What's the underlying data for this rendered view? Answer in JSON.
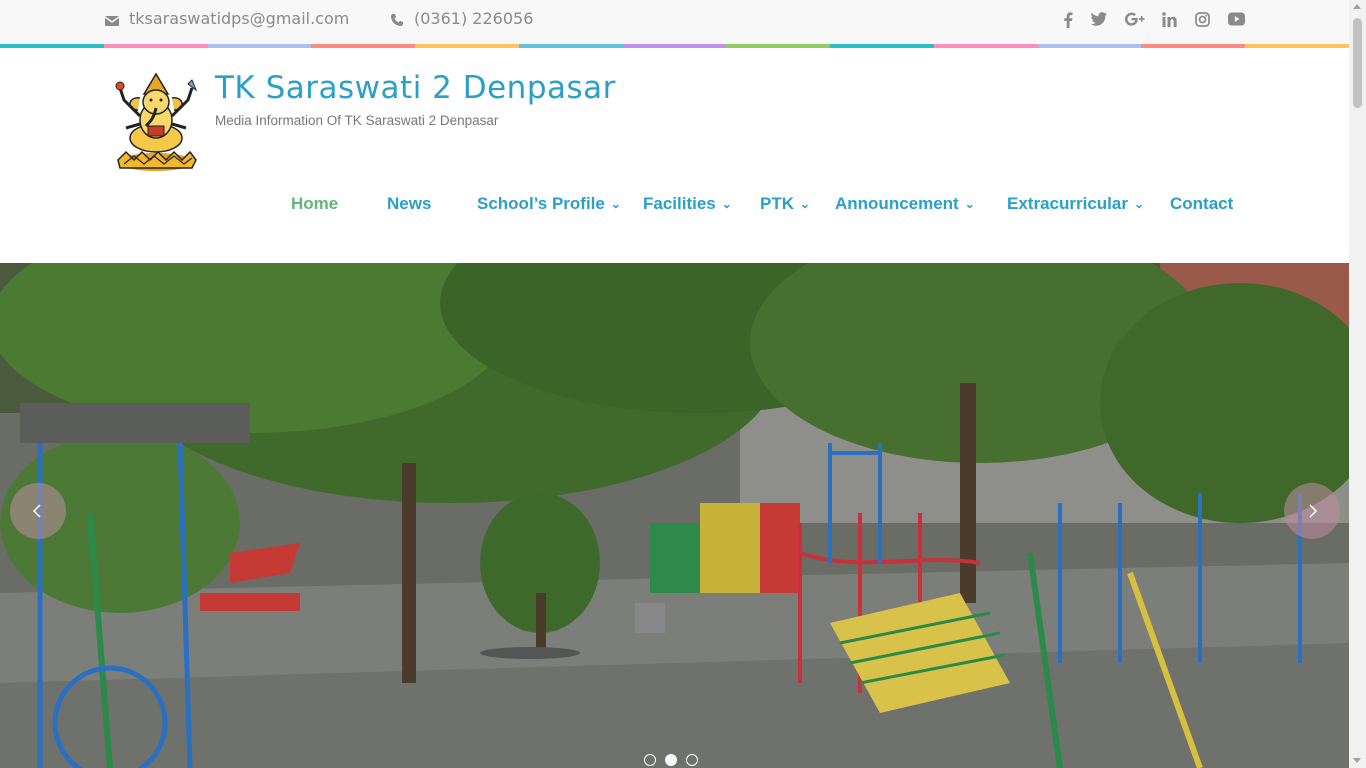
{
  "topbar": {
    "email": "tksaraswatidps@gmail.com",
    "phone": "(0361) 226056",
    "social": [
      "facebook-icon",
      "twitter-icon",
      "google-plus-icon",
      "linkedin-icon",
      "instagram-icon",
      "youtube-icon"
    ]
  },
  "stripe_colors": [
    "#2bbdc9",
    "#ff8fb8",
    "#a9c0f0",
    "#ff8a80",
    "#ffc25c",
    "#5ec2dd",
    "#c38ef3",
    "#8fcf62",
    "#2bbdc9",
    "#ff8fb8",
    "#a9c0f0",
    "#ff8a80",
    "#ffc25c"
  ],
  "site": {
    "title": "TK Saraswati 2 Denpasar",
    "tagline": "Media Information Of TK Saraswati 2 Denpasar"
  },
  "nav": {
    "home": "Home",
    "news": "News",
    "profile": "School’s Profile",
    "facilities": "Facilities",
    "ptk": "PTK",
    "announcement": "Announcement",
    "extracurricular": "Extracurricular",
    "contact": "Contact"
  },
  "slider": {
    "slide_count": 3,
    "active_slide": 2
  },
  "colors": {
    "nav_link": "#2aa0c8",
    "nav_active": "#5fb87a",
    "title": "#2aa0c8"
  }
}
